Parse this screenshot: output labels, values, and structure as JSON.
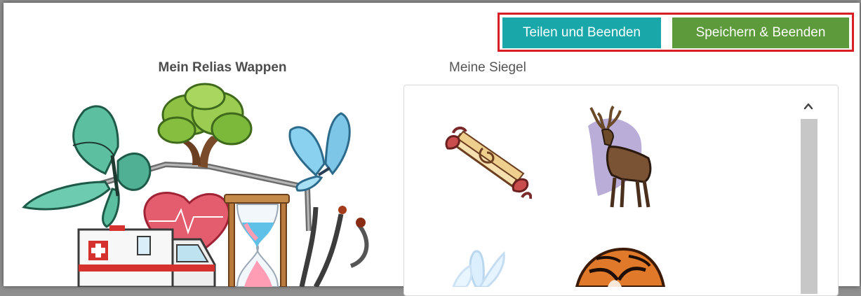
{
  "header": {
    "share_label": "Teilen und Beenden",
    "save_label": "Speichern & Beenden"
  },
  "crest_section": {
    "title": "Mein Relias Wappen",
    "items": [
      "butterfly-green",
      "tree",
      "butterfly-blue",
      "heart",
      "hourglass",
      "stethoscope",
      "ambulance"
    ]
  },
  "seals_section": {
    "title": "Meine Siegel",
    "items": [
      "scroll-icon",
      "deer-icon",
      "butterfly-icon",
      "tiger-icon"
    ]
  },
  "colors": {
    "share_button": "#1aa7aa",
    "save_button": "#5c9a3c",
    "highlight_border": "#d81f26"
  }
}
